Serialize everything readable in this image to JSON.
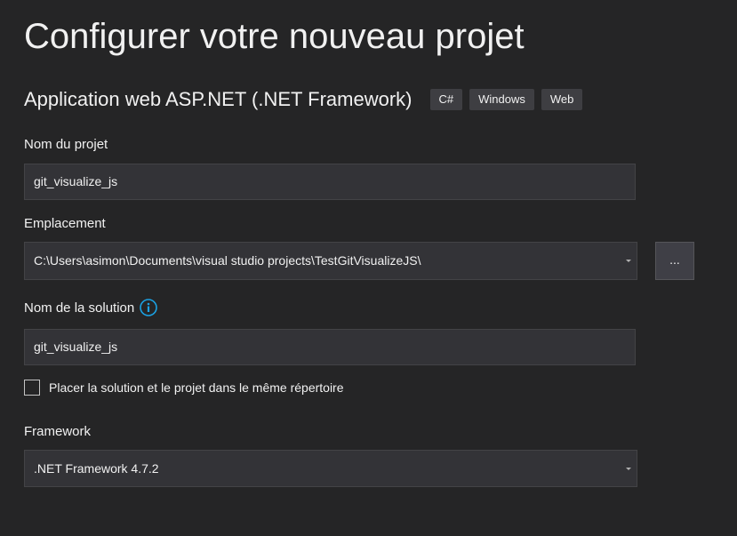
{
  "page": {
    "title": "Configurer votre nouveau projet"
  },
  "template": {
    "name": "Application web ASP.NET (.NET Framework)",
    "tags": [
      "C#",
      "Windows",
      "Web"
    ]
  },
  "project_name": {
    "label": "Nom du projet",
    "value": "git_visualize_js"
  },
  "location": {
    "label": "Emplacement",
    "value": "C:\\Users\\asimon\\Documents\\visual studio projects\\TestGitVisualizeJS\\",
    "browse_label": "..."
  },
  "solution_name": {
    "label": "Nom de la solution",
    "info_icon": "info-icon",
    "value": "git_visualize_js"
  },
  "same_directory": {
    "label": "Placer la solution et le projet dans le même répertoire",
    "checked": false
  },
  "framework": {
    "label": "Framework",
    "value": ".NET Framework 4.7.2"
  },
  "colors": {
    "background": "#252526",
    "input_background": "#333337",
    "info_accent": "#1ba1e2"
  }
}
